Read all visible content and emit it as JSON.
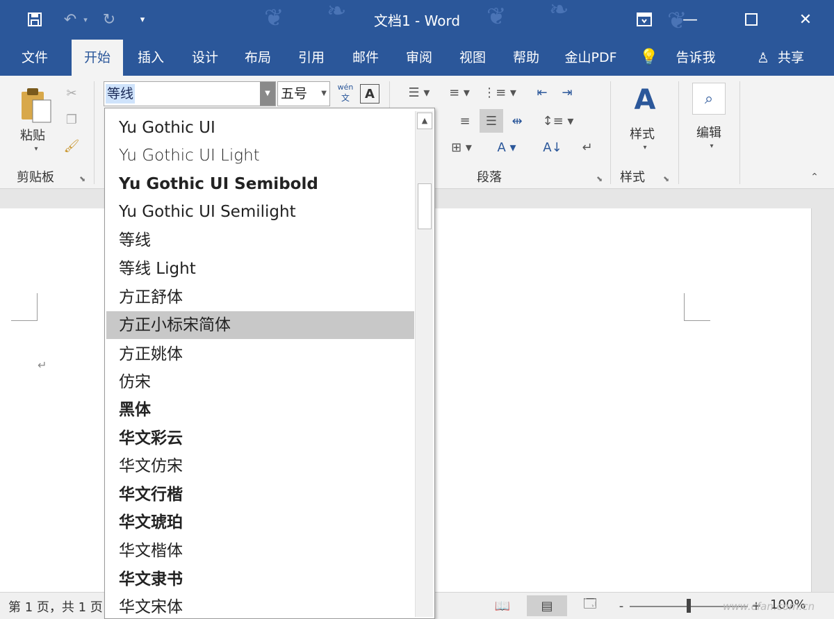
{
  "window": {
    "title": "文档1  -  Word",
    "undo_arrow": "▾",
    "customize_glyph": "▾"
  },
  "tabs": [
    "文件",
    "开始",
    "插入",
    "设计",
    "布局",
    "引用",
    "邮件",
    "审阅",
    "视图",
    "帮助",
    "金山PDF",
    "告诉我",
    "共享"
  ],
  "ribbon": {
    "clipboard": {
      "paste_label": "粘贴",
      "group_label": "剪贴板"
    },
    "font": {
      "current_font": "等线",
      "current_size": "五号",
      "phonetic_label": "wén",
      "phonetic_sub": "文",
      "border_label": "A"
    },
    "paragraph": {
      "group_label": "段落"
    },
    "styles": {
      "button_label": "样式",
      "group_label": "样式"
    },
    "editing": {
      "button_label": "编辑"
    }
  },
  "font_list": [
    {
      "name": "Yu Gothic UI",
      "weight": "normal"
    },
    {
      "name": "Yu Gothic UI Light",
      "weight": "300"
    },
    {
      "name": "Yu Gothic UI Semibold",
      "weight": "bold"
    },
    {
      "name": "Yu Gothic UI Semilight",
      "weight": "normal"
    },
    {
      "name": "等线",
      "weight": "normal"
    },
    {
      "name": "等线 Light",
      "weight": "normal"
    },
    {
      "name": "方正舒体",
      "weight": "normal"
    },
    {
      "name": "方正小标宋简体",
      "weight": "normal"
    },
    {
      "name": "方正姚体",
      "weight": "normal"
    },
    {
      "name": "仿宋",
      "weight": "normal"
    },
    {
      "name": "黑体",
      "weight": "bold"
    },
    {
      "name": "华文彩云",
      "weight": "bold"
    },
    {
      "name": "华文仿宋",
      "weight": "normal"
    },
    {
      "name": "华文行楷",
      "weight": "bold"
    },
    {
      "name": "华文琥珀",
      "weight": "bold"
    },
    {
      "name": "华文楷体",
      "weight": "normal"
    },
    {
      "name": "华文隶书",
      "weight": "bold"
    },
    {
      "name": "华文宋体",
      "weight": "normal"
    }
  ],
  "font_list_selected": "方正小标宋简体",
  "statusbar": {
    "page_info": "第 1 页，共 1 页",
    "zoom": "100%",
    "zoom_minus": "-",
    "zoom_plus": "+"
  },
  "watermark": "www.cfan.com.cn",
  "colors": {
    "title_bar": "#2b579a",
    "ribbon_bg": "#f3f3f3",
    "selected_item": "#c8c8c8"
  }
}
